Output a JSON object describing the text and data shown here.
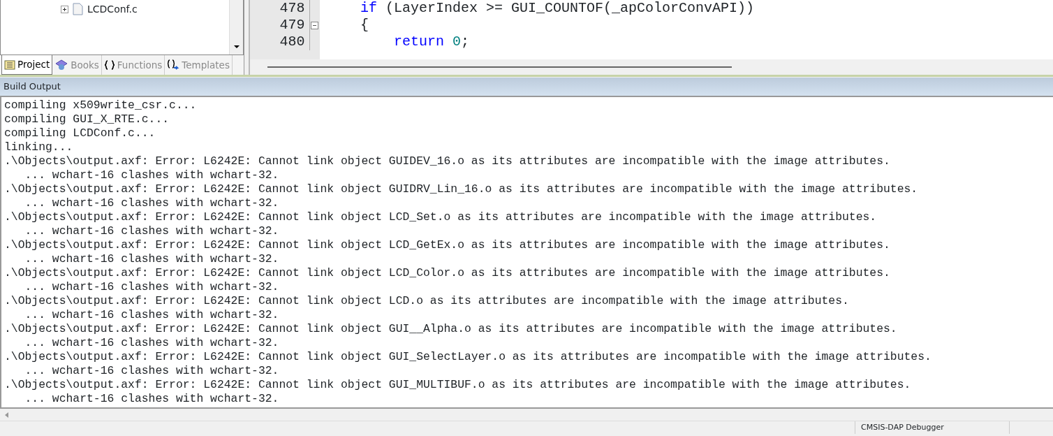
{
  "project_tree": {
    "items": [
      {
        "label": "LCDConf.c",
        "expanded": false
      }
    ]
  },
  "project_tabs": [
    {
      "label": "Project",
      "selected": true,
      "kind": "project"
    },
    {
      "label": "Books",
      "selected": false,
      "kind": "books"
    },
    {
      "label": "Functions",
      "selected": false,
      "kind": "functions"
    },
    {
      "label": "Templates",
      "selected": false,
      "kind": "templates"
    }
  ],
  "editor": {
    "lines": [
      {
        "number": "478",
        "foldable": false,
        "indented": false,
        "tokens": [
          {
            "kind": "keyword",
            "text": "if"
          },
          {
            "kind": "plain",
            "text": " (LayerIndex >= GUI_COUNTOF(_apColorConvAPI))"
          }
        ]
      },
      {
        "number": "479",
        "foldable": true,
        "indented": false,
        "tokens": [
          {
            "kind": "plain",
            "text": "{"
          }
        ]
      },
      {
        "number": "480",
        "foldable": false,
        "indented": true,
        "tokens": [
          {
            "kind": "keyword",
            "text": "return"
          },
          {
            "kind": "number",
            "text": "0"
          },
          {
            "kind": "plain",
            "text": ";"
          }
        ]
      }
    ]
  },
  "build_output": {
    "title": "Build Output",
    "lines": [
      "compiling x509write_csr.c...",
      "compiling GUI_X_RTE.c...",
      "compiling LCDConf.c...",
      "linking...",
      ".\\Objects\\output.axf: Error: L6242E: Cannot link object GUIDEV_16.o as its attributes are incompatible with the image attributes.",
      "   ... wchart-16 clashes with wchart-32.",
      ".\\Objects\\output.axf: Error: L6242E: Cannot link object GUIDRV_Lin_16.o as its attributes are incompatible with the image attributes.",
      "   ... wchart-16 clashes with wchart-32.",
      ".\\Objects\\output.axf: Error: L6242E: Cannot link object LCD_Set.o as its attributes are incompatible with the image attributes.",
      "   ... wchart-16 clashes with wchart-32.",
      ".\\Objects\\output.axf: Error: L6242E: Cannot link object LCD_GetEx.o as its attributes are incompatible with the image attributes.",
      "   ... wchart-16 clashes with wchart-32.",
      ".\\Objects\\output.axf: Error: L6242E: Cannot link object LCD_Color.o as its attributes are incompatible with the image attributes.",
      "   ... wchart-16 clashes with wchart-32.",
      ".\\Objects\\output.axf: Error: L6242E: Cannot link object LCD.o as its attributes are incompatible with the image attributes.",
      "   ... wchart-16 clashes with wchart-32.",
      ".\\Objects\\output.axf: Error: L6242E: Cannot link object GUI__Alpha.o as its attributes are incompatible with the image attributes.",
      "   ... wchart-16 clashes with wchart-32.",
      ".\\Objects\\output.axf: Error: L6242E: Cannot link object GUI_SelectLayer.o as its attributes are incompatible with the image attributes.",
      "   ... wchart-16 clashes with wchart-32.",
      ".\\Objects\\output.axf: Error: L6242E: Cannot link object GUI_MULTIBUF.o as its attributes are incompatible with the image attributes.",
      "   ... wchart-16 clashes with wchart-32."
    ]
  },
  "status_bar": {
    "debugger": "CMSIS-DAP Debugger"
  }
}
